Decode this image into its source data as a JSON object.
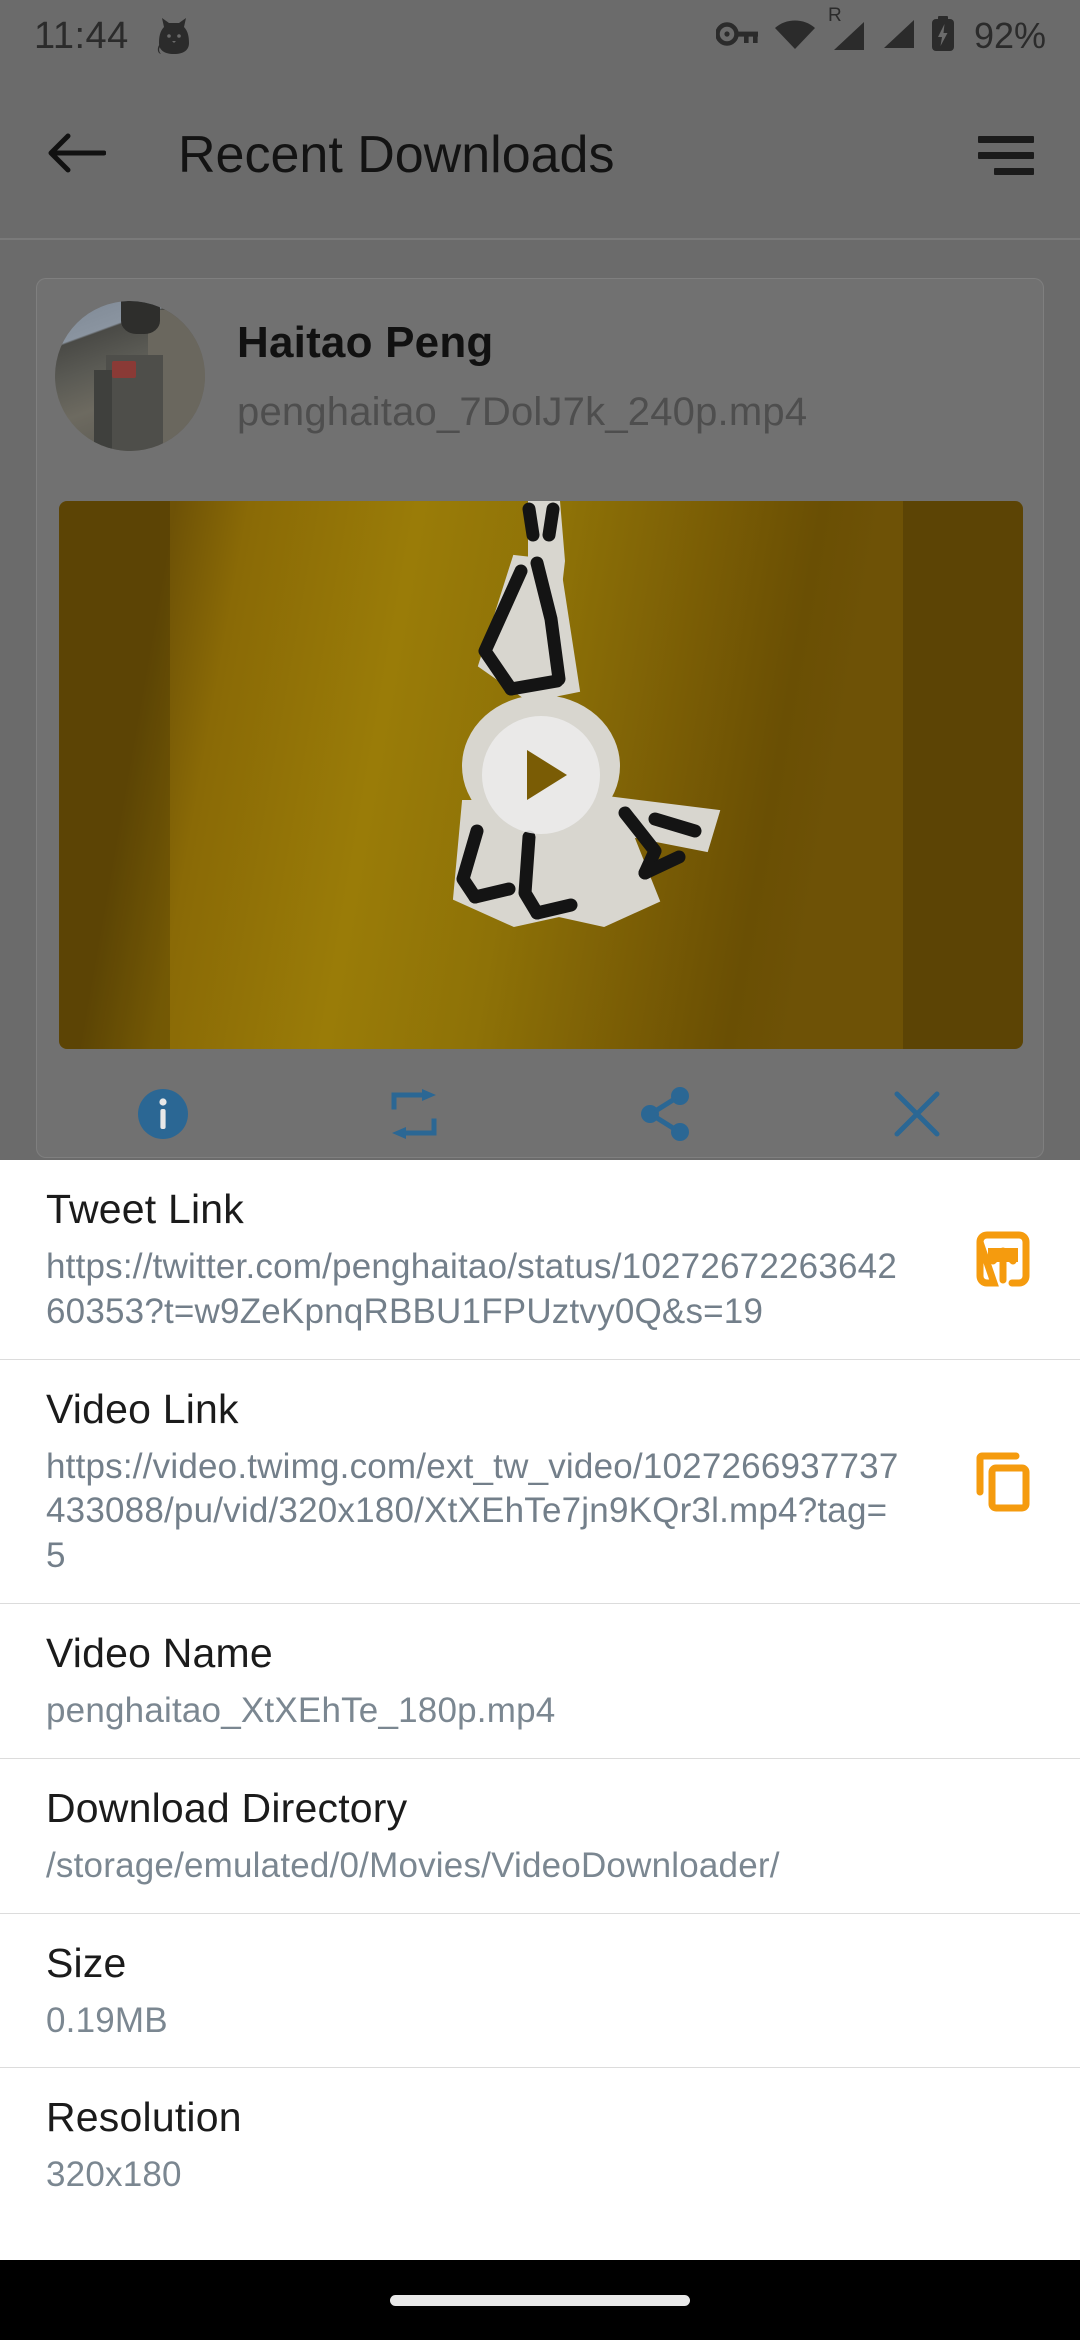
{
  "status_bar": {
    "time": "11:44",
    "battery_percent": "92%",
    "roaming_label": "R",
    "icons": [
      "cat-icon",
      "vpn-key-icon",
      "wifi-icon",
      "cellular-signal-icon",
      "cellular-signal-2-icon",
      "battery-charging-icon"
    ]
  },
  "app_bar": {
    "title": "Recent Downloads",
    "back_icon": "back-arrow-icon",
    "menu_icon": "sort-menu-icon"
  },
  "download_card": {
    "uploader": "Haitao Peng",
    "file_name": "penghaitao_7DolJ7k_240p.mp4",
    "avatar_icon": "avatar",
    "play_icon": "play-icon",
    "actions": [
      {
        "name": "info-button",
        "icon": "info-icon"
      },
      {
        "name": "retweet-button",
        "icon": "retweet-icon"
      },
      {
        "name": "share-button",
        "icon": "share-icon"
      },
      {
        "name": "close-button",
        "icon": "close-icon"
      }
    ]
  },
  "details": {
    "rows": [
      {
        "label": "Tweet Link",
        "value": "https://twitter.com/penghaitao/status/1027267226364260353?t=w9ZeKpnqRBBU1FPUztvy0Q&s=19",
        "action_icon": "open-in-browser-icon",
        "action_name": "open-tweet-link-button"
      },
      {
        "label": "Video Link",
        "value": "https://video.twimg.com/ext_tw_video/1027266937737433088/pu/vid/320x180/XtXEhTe7jn9KQr3l.mp4?tag=5",
        "action_icon": "copy-icon",
        "action_name": "copy-video-link-button"
      },
      {
        "label": "Video Name",
        "value": "penghaitao_XtXEhTe_180p.mp4"
      },
      {
        "label": "Download Directory",
        "value": "/storage/emulated/0/Movies/VideoDownloader/"
      },
      {
        "label": "Size",
        "value": "0.19MB"
      },
      {
        "label": "Resolution",
        "value": "320x180"
      }
    ]
  },
  "nav_bar": {
    "gesture_pill": "home-gesture-pill"
  },
  "colors": {
    "accent_orange": "#F59B0E",
    "action_blue": "#2B6794",
    "scrim": "#6b6b6b",
    "sheet_bg": "#ffffff",
    "label_text": "#1b1b1b",
    "value_text": "#737f8a"
  }
}
